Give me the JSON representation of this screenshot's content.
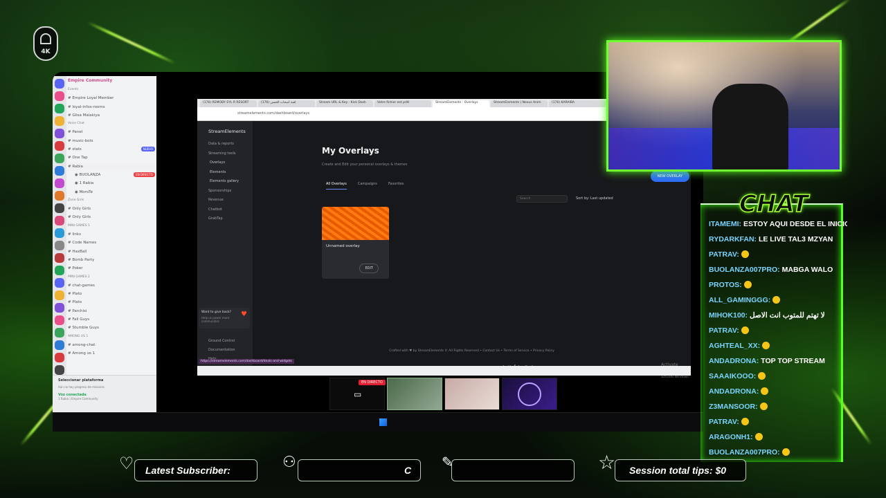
{
  "logo": {
    "text": "4K"
  },
  "discord": {
    "server_name": "Empire Community",
    "channels": [
      {
        "label": "Events",
        "type": "cat"
      },
      {
        "label": "Empire Loyal Member",
        "type": "ch"
      },
      {
        "label": "loyal-infos-rooms",
        "type": "ch"
      },
      {
        "label": "Glisa Malakiya",
        "type": "ch"
      },
      {
        "label": "Voice Chat",
        "type": "cat"
      },
      {
        "label": "Panel",
        "type": "ch"
      },
      {
        "label": "music-bots",
        "type": "ch"
      },
      {
        "label": "stats",
        "type": "ch",
        "badge": "NUEVO"
      },
      {
        "label": "One Tap",
        "type": "ch"
      },
      {
        "label": "Rabia",
        "type": "live"
      },
      {
        "label": "BUOLANZA",
        "type": "user",
        "badge": "EN DIRECTO",
        "red": true
      },
      {
        "label": "1 Rabia",
        "type": "user"
      },
      {
        "label": "MoroTe",
        "type": "user"
      },
      {
        "label": "Zone Girls",
        "type": "cat"
      },
      {
        "label": "Only Girls",
        "type": "ch"
      },
      {
        "label": "Only Girls",
        "type": "ch"
      },
      {
        "label": "MINI GAMES 1",
        "type": "cat"
      },
      {
        "label": "links",
        "type": "ch"
      },
      {
        "label": "Code Names",
        "type": "ch"
      },
      {
        "label": "HaxBall",
        "type": "ch"
      },
      {
        "label": "Bomb Party",
        "type": "ch"
      },
      {
        "label": "Poker",
        "type": "ch"
      },
      {
        "label": "MINI GAMES 2",
        "type": "cat"
      },
      {
        "label": "chat-games",
        "type": "ch"
      },
      {
        "label": "Plato",
        "type": "ch"
      },
      {
        "label": "Plato",
        "type": "ch"
      },
      {
        "label": "Parchisi",
        "type": "ch"
      },
      {
        "label": "Fall Guys",
        "type": "ch"
      },
      {
        "label": "Stumble Guys",
        "type": "ch"
      },
      {
        "label": "AMONG US 1",
        "type": "cat"
      },
      {
        "label": "among-chat",
        "type": "ch"
      },
      {
        "label": "Among us 1",
        "type": "ch"
      }
    ],
    "platform_label": "Seleccionar plataforma",
    "platform_sub": "Aún no hay progreso de misiones",
    "voice_status": "Voz conectada",
    "voice_sub": "1 Rabia | Empire Community"
  },
  "browser": {
    "tabs": [
      "(176) REMODY EYL R RESORT",
      "(176) لعبة أصحاب الحسن",
      "Stream URL & Key - Kick Dash",
      "Votre fichier est prêt",
      "StreamElements - Overlays",
      "StreamElements | Nexus Anim",
      "(176) KARAIBA"
    ],
    "url": "streamelements.com/dashboard/overlays",
    "brand": "StreamElements",
    "sidebar": [
      {
        "label": "Data & reports",
        "sub": false
      },
      {
        "label": "Streaming tools",
        "sub": false
      },
      {
        "label": "Overlays",
        "sub": true
      },
      {
        "label": "Elements",
        "sub": true
      },
      {
        "label": "Elements gallery",
        "sub": true
      },
      {
        "label": "Sponsorships",
        "sub": false
      },
      {
        "label": "Revenue",
        "sub": false
      },
      {
        "label": "Chatbot",
        "sub": false
      },
      {
        "label": "GrabTap",
        "sub": false
      }
    ],
    "bottom_links": [
      "Ground Control",
      "Documentation",
      "Help"
    ],
    "giveback_title": "Want to give back?",
    "giveback_sub": "Help us power more communities",
    "page_title": "My Overlays",
    "page_desc": "Create and Edit your personal overlays & themes",
    "new_button": "NEW OVERLAY",
    "tabs_main": [
      "All Overlays",
      "Campaigns",
      "Favorites"
    ],
    "search_placeholder": "Search",
    "sort_label": "Sort by: Last updated",
    "card_name": "Unnamed overlay",
    "card_edit": "EDIT",
    "footer": "Crafted with ♥ by StreamElements © All Rights Reserved • Contact Us • Terms of Service • Privacy Policy",
    "activate_title": "Activate Windows",
    "activate_sub": "Go to Settings to activate Windows.",
    "tooltip": "https://streamelements.com/dashboard/deals-and-widgets"
  },
  "dock": {
    "live_badge": "EN DIRECTO"
  },
  "chat": {
    "title": "CHAT",
    "messages": [
      {
        "user": "ITAMEMI:",
        "text": "ESTOY AQUI DESDE EL INICIO"
      },
      {
        "user": "RYDARKFAN:",
        "text": "LE LIVE TAL3 MZYAN"
      },
      {
        "user": "PATRAV:",
        "text": "",
        "emoji": true
      },
      {
        "user": "BUOLANZA007PRO:",
        "text": "MABGA WALO"
      },
      {
        "user": "PROTOS:",
        "text": "",
        "emoji": true
      },
      {
        "user": "ALL_GAMINGGG:",
        "text": "",
        "emoji": true
      },
      {
        "user": "MIHOK100:",
        "text": "لا تهتم للمتوب انت الاصل"
      },
      {
        "user": "PATRAV:",
        "text": "",
        "emoji": true
      },
      {
        "user": "AGHTEAL_XX:",
        "text": "",
        "emoji": true
      },
      {
        "user": "ANDADRONA:",
        "text": "TOP TOP STREAM"
      },
      {
        "user": "SAAAIKOOO:",
        "text": "",
        "emoji": true
      },
      {
        "user": "ANDADRONA:",
        "text": "",
        "emoji": true
      },
      {
        "user": "Z3MANSOOR:",
        "text": "",
        "emoji": true
      },
      {
        "user": "PATRAV:",
        "text": "",
        "emoji": true
      },
      {
        "user": "ARAGONH1:",
        "text": "",
        "emoji": true
      },
      {
        "user": "BUOLANZA007PRO:",
        "text": "",
        "emoji": true
      }
    ]
  },
  "bottom": {
    "latest_sub": "Latest Subscriber:",
    "follower_text": "C",
    "session_tips": "Session total tips: $0"
  }
}
